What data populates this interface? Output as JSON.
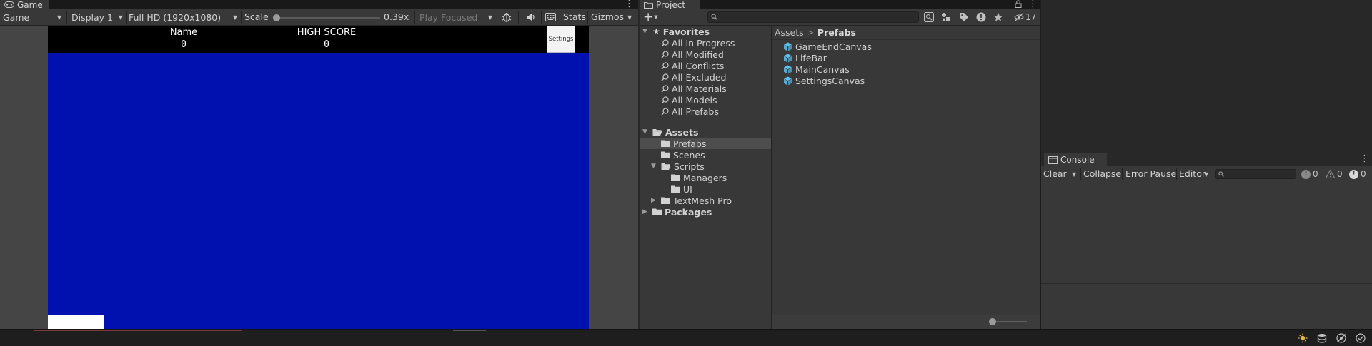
{
  "game_panel": {
    "tab_title": "Game",
    "view_mode": "Game",
    "display": "Display 1",
    "resolution": "Full HD (1920x1080)",
    "scale_label": "Scale",
    "scale_value": "0.39x",
    "scale_level": 0.0,
    "play_mode": "Play Focused",
    "stats_label": "Stats",
    "gizmos_label": "Gizmos"
  },
  "game_hud": {
    "name_label": "Name",
    "name_value": "0",
    "high_score_label": "HIGH SCORE",
    "high_score_value": "0",
    "settings_label": "Settings",
    "background_color": "#0011b0"
  },
  "project_panel": {
    "tab_title": "Project",
    "hidden_count": "17",
    "favorites_label": "Favorites",
    "favorites": [
      "All In Progress",
      "All Modified",
      "All Conflicts",
      "All Excluded",
      "All Materials",
      "All Models",
      "All Prefabs"
    ],
    "assets_label": "Assets",
    "folders": {
      "prefabs": "Prefabs",
      "scenes": "Scenes",
      "scripts": "Scripts",
      "managers": "Managers",
      "ui": "UI",
      "textmesh": "TextMesh Pro"
    },
    "packages_label": "Packages",
    "breadcrumb": [
      "Assets",
      "Prefabs"
    ],
    "files": [
      "GameEndCanvas",
      "LifeBar",
      "MainCanvas",
      "SettingsCanvas"
    ]
  },
  "console_panel": {
    "tab_title": "Console",
    "clear_label": "Clear",
    "collapse_label": "Collapse",
    "error_pause_label": "Error Pause",
    "editor_label": "Editor",
    "log_count": "0",
    "warning_count": "0",
    "error_count": "0"
  },
  "colors": {
    "accent": "#4a9ff5",
    "prefab_icon": "#5ec2f0"
  }
}
